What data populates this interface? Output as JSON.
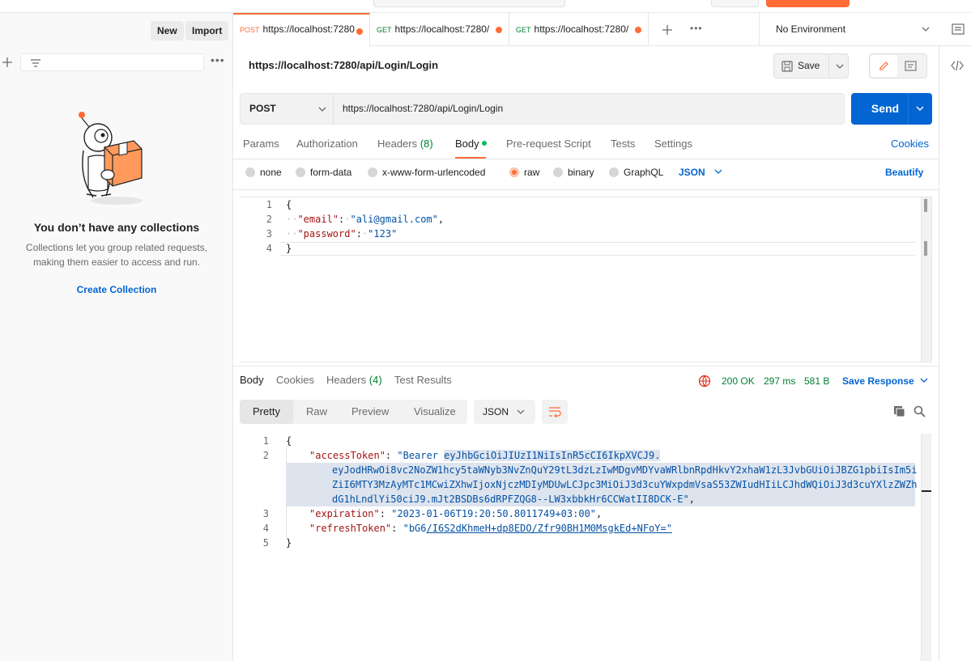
{
  "sidebar": {
    "new_label": "New",
    "import_label": "Import",
    "empty_title": "You don’t have any collections",
    "empty_desc_line1": "Collections let you group related requests,",
    "empty_desc_line2": "making them easier to access and run.",
    "create_link": "Create Collection"
  },
  "tabs": [
    {
      "method": "POST",
      "url": "https://localhost:7280",
      "method_color": "#ff6c37"
    },
    {
      "method": "GET",
      "url": "https://localhost:7280/",
      "method_color": "#007f31"
    },
    {
      "method": "GET",
      "url": "https://localhost:7280/",
      "method_color": "#007f31"
    }
  ],
  "environment": "No Environment",
  "request": {
    "title": "https://localhost:7280/api/Login/Login",
    "save_label": "Save",
    "method": "POST",
    "url": "https://localhost:7280/api/Login/Login",
    "send_label": "Send",
    "tabs": {
      "params": "Params",
      "authorization": "Authorization",
      "headers": "Headers",
      "headers_count": "(8)",
      "body": "Body",
      "prerequest": "Pre-request Script",
      "tests": "Tests",
      "settings": "Settings",
      "cookies": "Cookies"
    },
    "body_types": {
      "none": "none",
      "form_data": "form-data",
      "urlencoded": "x-www-form-urlencoded",
      "raw": "raw",
      "binary": "binary",
      "graphql": "GraphQL",
      "lang": "JSON",
      "beautify": "Beautify"
    },
    "code": {
      "l1": "{",
      "l2_key": "\"email\"",
      "l2_val": "\"ali@gmail.com\"",
      "l3_key": "\"password\"",
      "l3_val": "\"123\"",
      "l4": "}"
    }
  },
  "response": {
    "tabs": {
      "body": "Body",
      "cookies": "Cookies",
      "headers": "Headers",
      "headers_count": "(4)",
      "test_results": "Test Results"
    },
    "status": "200 OK",
    "time": "297 ms",
    "size": "581 B",
    "save_response": "Save Response",
    "views": {
      "pretty": "Pretty",
      "raw": "Raw",
      "preview": "Preview",
      "visualize": "Visualize"
    },
    "format": "JSON",
    "code": {
      "open": "{",
      "k1": "\"accessToken\"",
      "v1_prefix": "\"Bearer ",
      "v1_a": "eyJhbGciOiJIUzI1NiIsInR5cCI6IkpXVCJ9.",
      "v1_b": "eyJodHRwOi8vc2NoZW1hcy5taWNyb3NvZnQuY29tL3dzLzIwMDgvMDYvaWRlbnRpdHkvY2xhaW1zL3JvbGUiOiJBZG1pbiIsIm5i",
      "v1_c": "ZiI6MTY3MzAyMTc1MCwiZXhwIjoxNjczMDIyMDUwLCJpc3MiOiJ3d3cuYWxpdmVsaS53ZWIudHIiLCJhdWQiOiJ3d3cuYXlzZWZh",
      "v1_d": "dG1hLndlYi50ciJ9.mJt2BSDBs6dRPFZQG8--LW3xbbkHr6CCWatII8DCK-E\"",
      "k2": "\"expiration\"",
      "v2": "\"2023-01-06T19:20:50.8011749+03:00\"",
      "k3": "\"refreshToken\"",
      "v3a": "\"bG6",
      "v3b": "/I6S2dKhmeH+dp8EDO/Zfr90BH1M0MsgkEd+NFoY=\"",
      "close": "}"
    }
  }
}
